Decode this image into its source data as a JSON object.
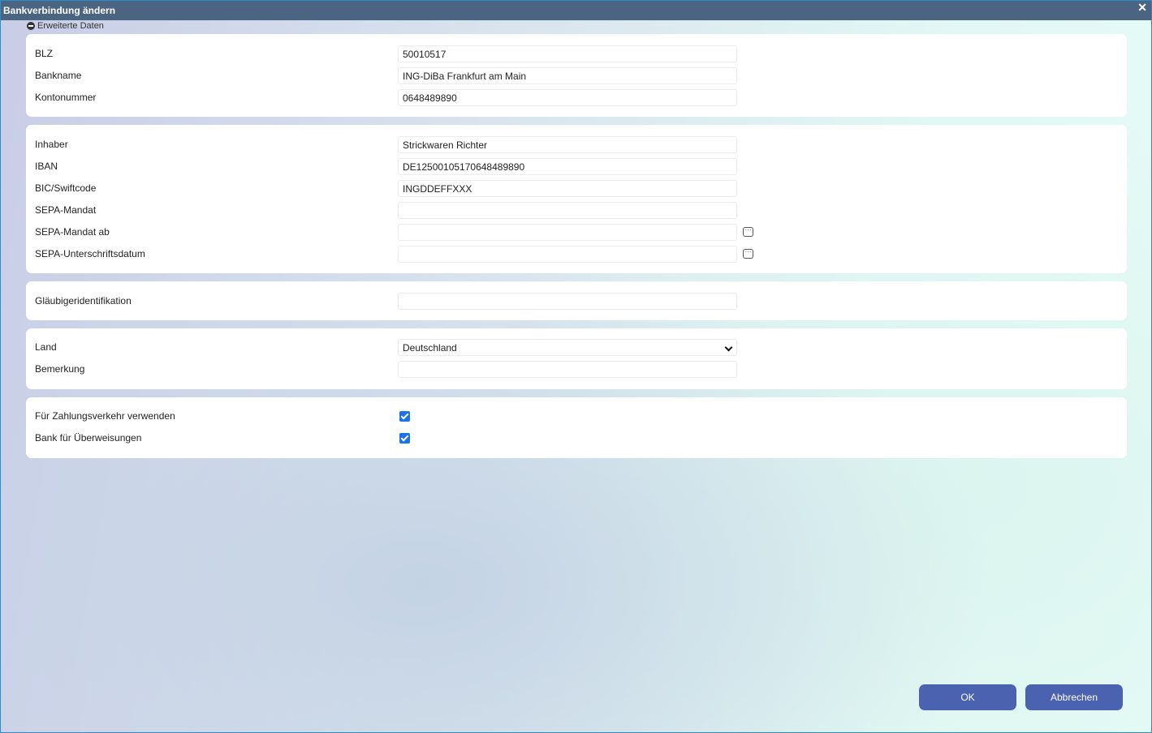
{
  "title": "Bankverbindung ändern",
  "section_toggle": "Erweiterte Daten",
  "panel1": [
    {
      "label": "BLZ",
      "value": "50010517"
    },
    {
      "label": "Bankname",
      "value": "ING-DiBa Frankfurt am Main"
    },
    {
      "label": "Kontonummer",
      "value": "0648489890"
    }
  ],
  "panel2": [
    {
      "label": "Inhaber",
      "value": "Strickwaren Richter"
    },
    {
      "label": "IBAN",
      "value": "DE12500105170648489890"
    },
    {
      "label": "BIC/Swiftcode",
      "value": "INGDDEFFXXX"
    },
    {
      "label": "SEPA-Mandat",
      "value": ""
    },
    {
      "label": "SEPA-Mandat ab",
      "value": ""
    },
    {
      "label": "SEPA-Unterschriftsdatum",
      "value": ""
    }
  ],
  "panel3": [
    {
      "label": "Gläubigeridentifikation",
      "value": ""
    }
  ],
  "panel4": [
    {
      "label": "Land",
      "value": "Deutschland"
    },
    {
      "label": "Bemerkung",
      "value": ""
    }
  ],
  "panel5": [
    {
      "label": "Für Zahlungsverkehr verwenden",
      "checked": true
    },
    {
      "label": "Bank für Überweisungen",
      "checked": true
    }
  ],
  "buttons": {
    "ok": "OK",
    "cancel": "Abbrechen"
  },
  "colors": {
    "titlebar": "#4a6482",
    "button": "#4a62b0",
    "checkbox": "#1a73e8"
  }
}
